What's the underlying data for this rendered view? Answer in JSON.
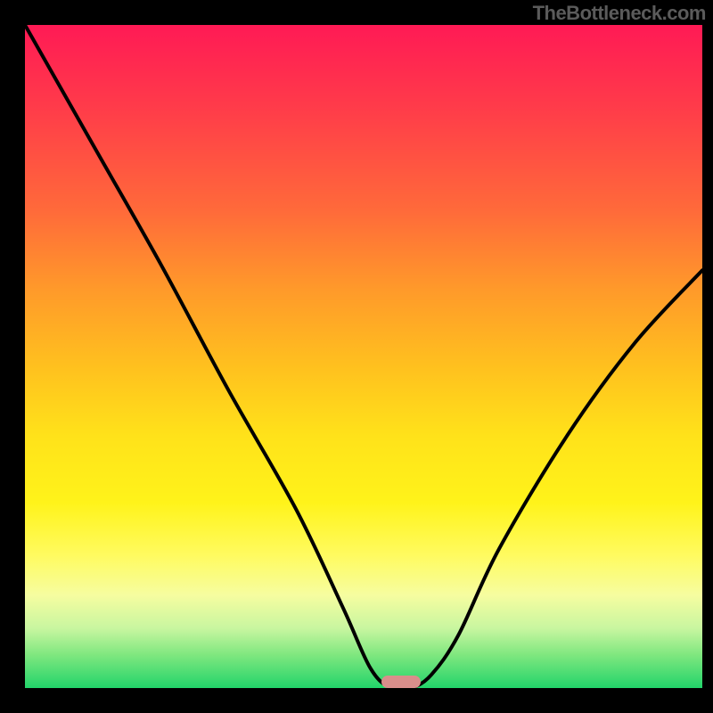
{
  "attribution": "TheBottleneck.com",
  "colors": {
    "frame_bg": "#000000",
    "attribution_text": "#5b5b5b",
    "curve_stroke": "#000000",
    "marker_fill": "#d98e8b",
    "gradient_top": "#ff1a55",
    "gradient_bottom": "#22d46a"
  },
  "chart_data": {
    "type": "line",
    "title": "",
    "xlabel": "",
    "ylabel": "",
    "xlim": [
      0,
      100
    ],
    "ylim": [
      0,
      100
    ],
    "series": [
      {
        "name": "bottleneck-curve",
        "x": [
          0,
          10,
          20,
          30,
          40,
          47,
          51,
          54,
          57,
          60,
          64,
          70,
          80,
          90,
          100
        ],
        "values": [
          100,
          82,
          64,
          45,
          27,
          12,
          3,
          0,
          0,
          2,
          8,
          21,
          38,
          52,
          63
        ]
      }
    ],
    "marker": {
      "x": 55.5,
      "y": 0,
      "label": ""
    },
    "grid": false,
    "legend": false
  }
}
